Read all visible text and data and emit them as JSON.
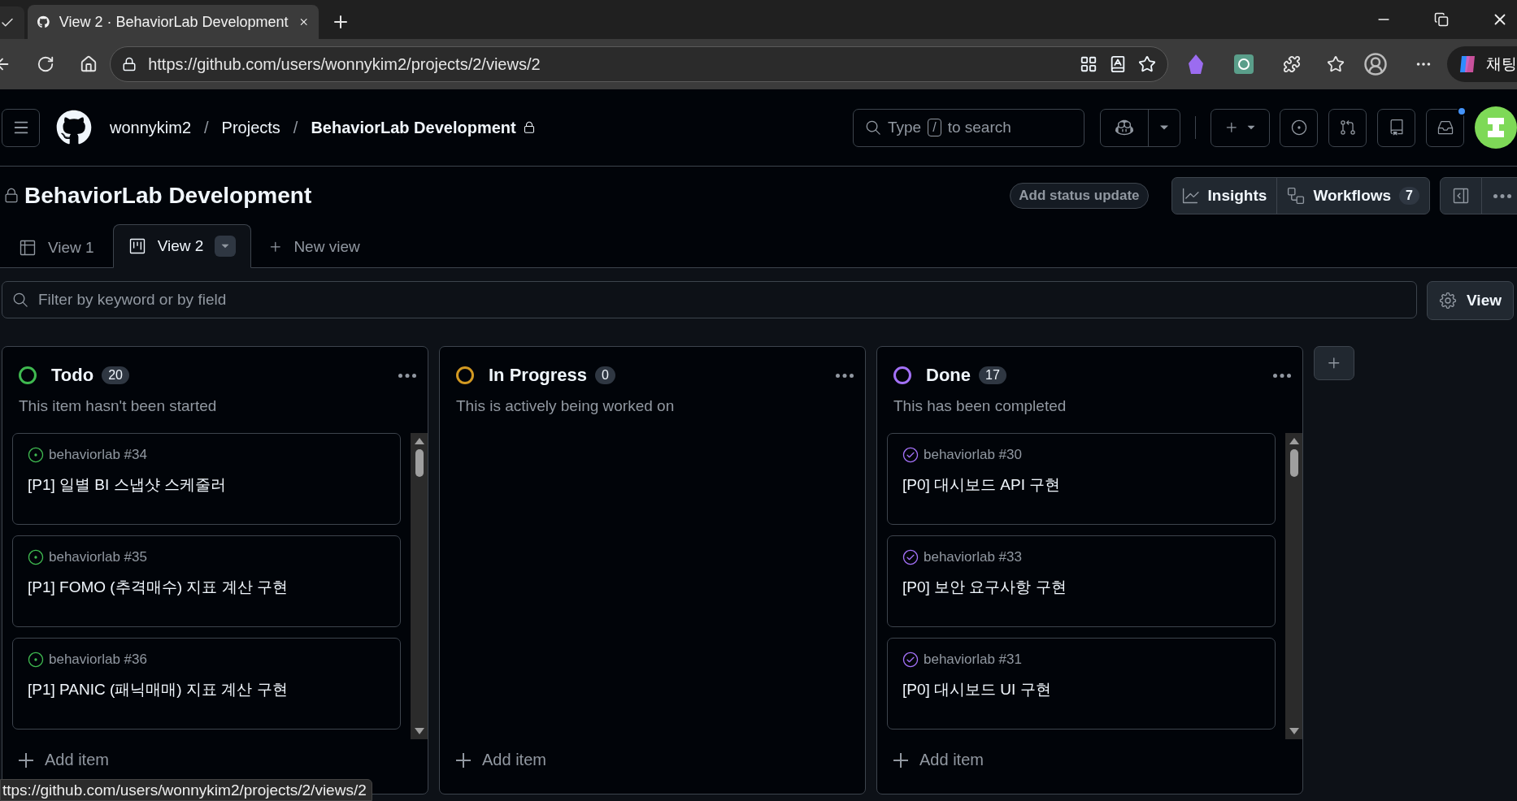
{
  "browser": {
    "active_tab_title": "View 2 · BehaviorLab Development",
    "address": "https://github.com/users/wonnykim2/projects/2/views/2",
    "chat_label": "채팅"
  },
  "header": {
    "breadcrumbs": [
      "wonnykim2",
      "Projects",
      "BehaviorLab Development"
    ],
    "breadcrumb_separators": [
      "/",
      "/"
    ],
    "search_before": "Type",
    "search_key": "/",
    "search_after": "to search",
    "has_notifications": true
  },
  "project": {
    "title": "BehaviorLab Development",
    "status_button": "Add status update",
    "insights": "Insights",
    "workflows": "Workflows",
    "workflows_count": "7"
  },
  "views": [
    {
      "label": "View 1",
      "kind": "table",
      "selected": false
    },
    {
      "label": "View 2",
      "kind": "board",
      "selected": true
    }
  ],
  "new_view": "New view",
  "filter": {
    "placeholder": "Filter by keyword or by field",
    "view_button": "View"
  },
  "columns": [
    {
      "name": "Todo",
      "count": "20",
      "description": "This item hasn't been started",
      "color": "#3fb950",
      "add_item": "Add item",
      "items": [
        {
          "repo": "behaviorlab #34",
          "title": "[P1] 일별 BI 스냅샷 스케줄러",
          "kind": "open"
        },
        {
          "repo": "behaviorlab #35",
          "title": "[P1] FOMO (추격매수) 지표 계산 구현",
          "kind": "open"
        },
        {
          "repo": "behaviorlab #36",
          "title": "[P1] PANIC (패닉매매) 지표 계산 구현",
          "kind": "open"
        }
      ]
    },
    {
      "name": "In Progress",
      "count": "0",
      "description": "This is actively being worked on",
      "color": "#d29922",
      "add_item": "Add item"
    },
    {
      "name": "Done",
      "count": "17",
      "description": "This has been completed",
      "color": "#a371f7",
      "add_item": "Add item",
      "items": [
        {
          "repo": "behaviorlab #30",
          "title": "[P0] 대시보드 API 구현",
          "kind": "closed"
        },
        {
          "repo": "behaviorlab #33",
          "title": "[P0] 보안 요구사항 구현",
          "kind": "closed"
        },
        {
          "repo": "behaviorlab #31",
          "title": "[P0] 대시보드 UI 구현",
          "kind": "closed"
        }
      ]
    }
  ],
  "status_bar_url": "ttps://github.com/users/wonnykim2/projects/2/views/2"
}
